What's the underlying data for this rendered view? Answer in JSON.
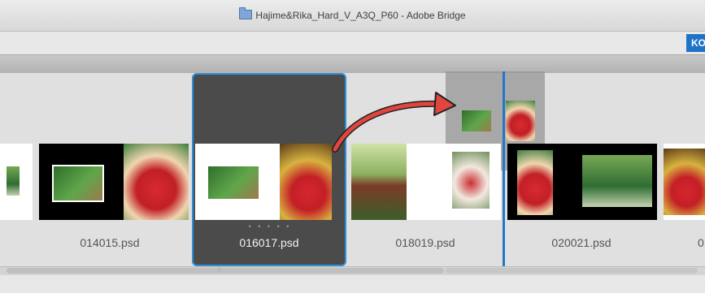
{
  "window": {
    "title": "Hajime&Rika_Hard_V_A3Q_P60 - Adobe Bridge"
  },
  "toolbar": {
    "right_button_label": "KO"
  },
  "filmstrip": {
    "items": [
      {
        "label": "014015.psd"
      },
      {
        "label": "016017.psd",
        "selected": true
      },
      {
        "label": "018019.psd"
      },
      {
        "label": "020021.psd"
      },
      {
        "label": "0"
      }
    ],
    "page_dots": "• • • • •"
  },
  "colors": {
    "selection_border": "#2f8fd9",
    "drop_indicator": "#2277c8",
    "arrow": "#e0463e",
    "accent_button": "#1e73c8"
  },
  "icons": {
    "title_folder": "folder-icon",
    "scroll_grip": "grip-icon"
  }
}
